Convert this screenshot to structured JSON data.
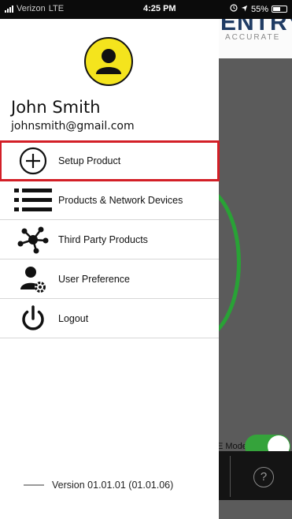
{
  "status_bar": {
    "carrier": "Verizon",
    "network": "LTE",
    "time": "4:25 PM",
    "battery": "55%",
    "icons": [
      "signal-icon",
      "alarm-icon",
      "location-icon",
      "battery-icon"
    ]
  },
  "background_app": {
    "logo_title": "ENTRY",
    "logo_sub": "ACCURATE",
    "mode_label": "E Mode",
    "help_symbol": "?",
    "colors": {
      "ring": "#29a236",
      "toggle": "#35a33b",
      "logo": "#1f3b63"
    }
  },
  "drawer": {
    "avatar_icon": "user-silhouette-icon",
    "user": {
      "name": "John Smith",
      "email": "johnsmith@gmail.com"
    },
    "menu": [
      {
        "label": "Setup Product",
        "icon": "plus-circle-icon"
      },
      {
        "label": "Products & Network Devices",
        "icon": "list-icon"
      },
      {
        "label": "Third Party Products",
        "icon": "network-nodes-icon"
      },
      {
        "label": "User Preference",
        "icon": "user-gear-icon"
      },
      {
        "label": "Logout",
        "icon": "power-icon"
      }
    ],
    "version": "Version 01.01.01 (01.01.06)",
    "colors": {
      "avatar_bg": "#f4e41d",
      "highlight": "#d31f27"
    }
  }
}
